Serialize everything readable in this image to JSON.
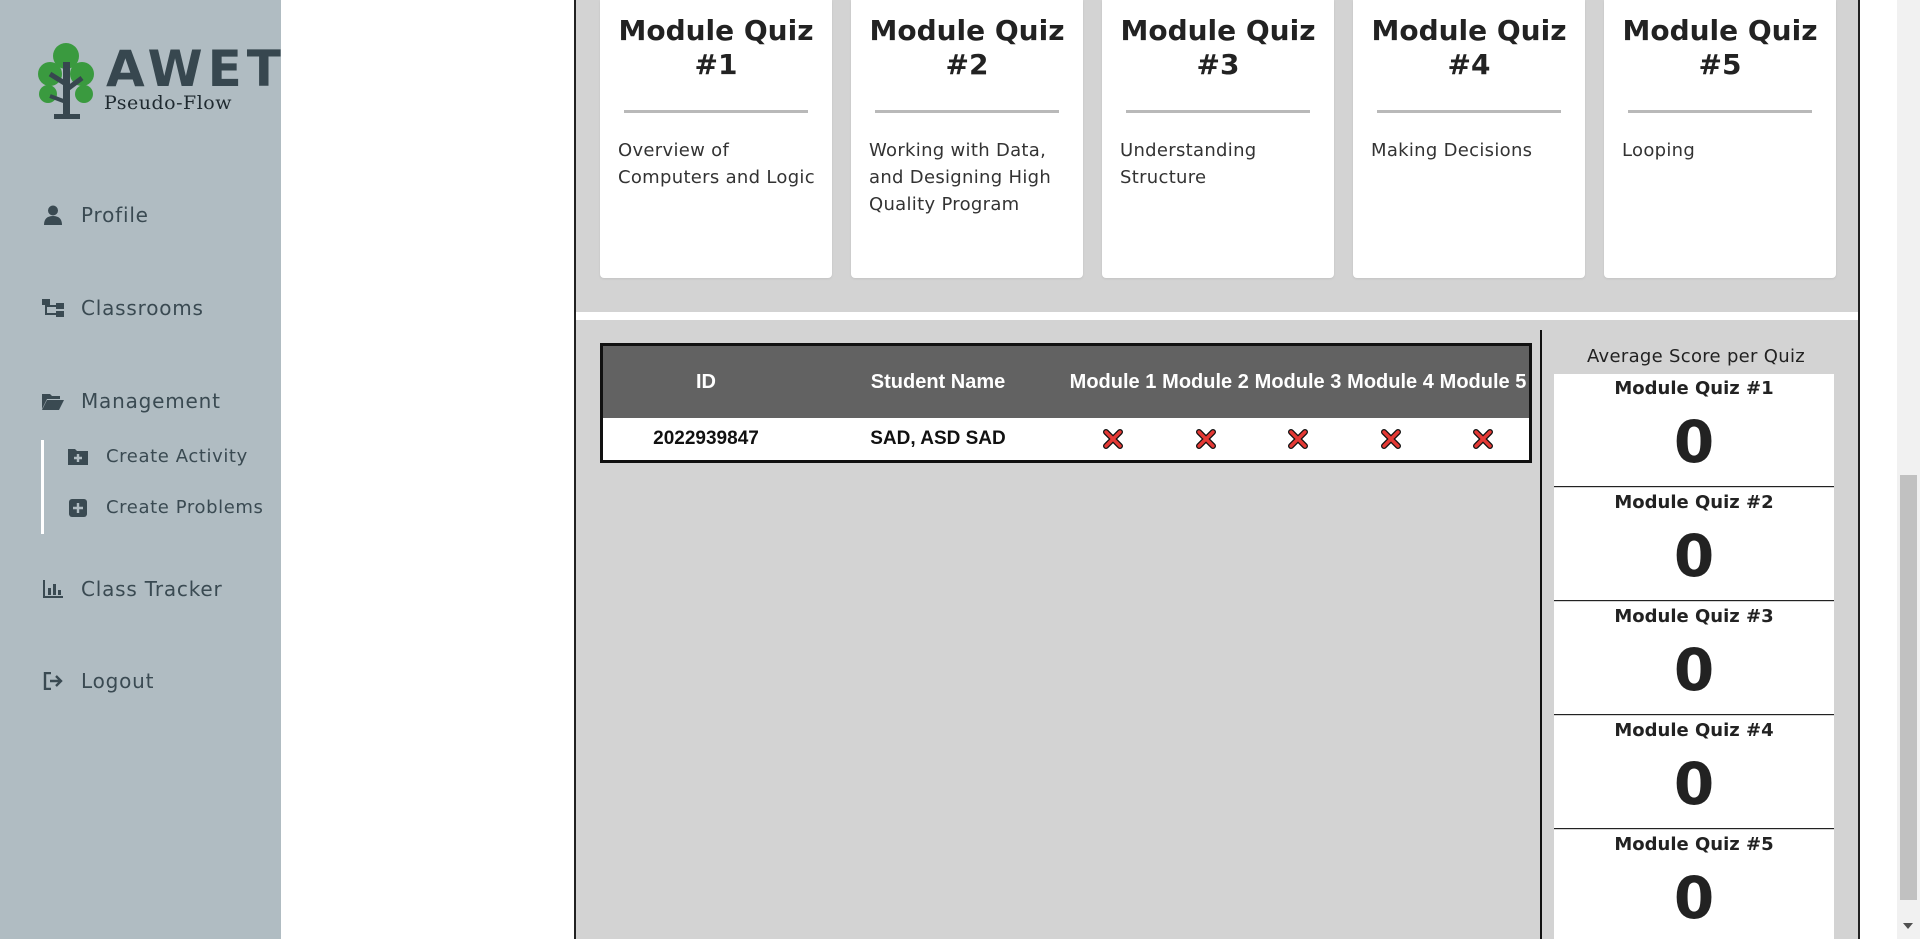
{
  "brand": {
    "title": "AWET",
    "subtitle": "Pseudo-Flow",
    "accent": "#3a9a3f"
  },
  "sidebar": {
    "items": [
      {
        "label": "Profile",
        "icon": "user-icon"
      },
      {
        "label": "Classrooms",
        "icon": "sitemap-icon"
      },
      {
        "label": "Management",
        "icon": "folder-open-icon"
      },
      {
        "label": "Class Tracker",
        "icon": "bar-chart-icon"
      },
      {
        "label": "Logout",
        "icon": "logout-icon"
      }
    ],
    "management_sub": [
      {
        "label": "Create Activity",
        "icon": "folder-plus-icon"
      },
      {
        "label": "Create Problems",
        "icon": "plus-square-icon"
      }
    ]
  },
  "quizzes": [
    {
      "title": "Module Quiz #1",
      "description": "Overview of Computers and Logic"
    },
    {
      "title": "Module Quiz #2",
      "description": "Working with Data, and Designing High Quality Program"
    },
    {
      "title": "Module Quiz #3",
      "description": "Understanding Structure"
    },
    {
      "title": "Module Quiz #4",
      "description": "Making Decisions"
    },
    {
      "title": "Module Quiz #5",
      "description": "Looping"
    }
  ],
  "table": {
    "headers": [
      "ID",
      "Student Name",
      "Module 1",
      "Module 2",
      "Module 3",
      "Module 4",
      "Module 5"
    ],
    "rows": [
      {
        "id": "2022939847",
        "name": "SAD, ASD SAD",
        "modules": [
          "incomplete",
          "incomplete",
          "incomplete",
          "incomplete",
          "incomplete"
        ]
      }
    ],
    "status_color": "#e53935"
  },
  "stats": {
    "title": "Average Score per Quiz",
    "items": [
      {
        "label": "Module Quiz #1",
        "value": "0"
      },
      {
        "label": "Module Quiz #2",
        "value": "0"
      },
      {
        "label": "Module Quiz #3",
        "value": "0"
      },
      {
        "label": "Module Quiz #4",
        "value": "0"
      },
      {
        "label": "Module Quiz #5",
        "value": "0"
      }
    ]
  }
}
